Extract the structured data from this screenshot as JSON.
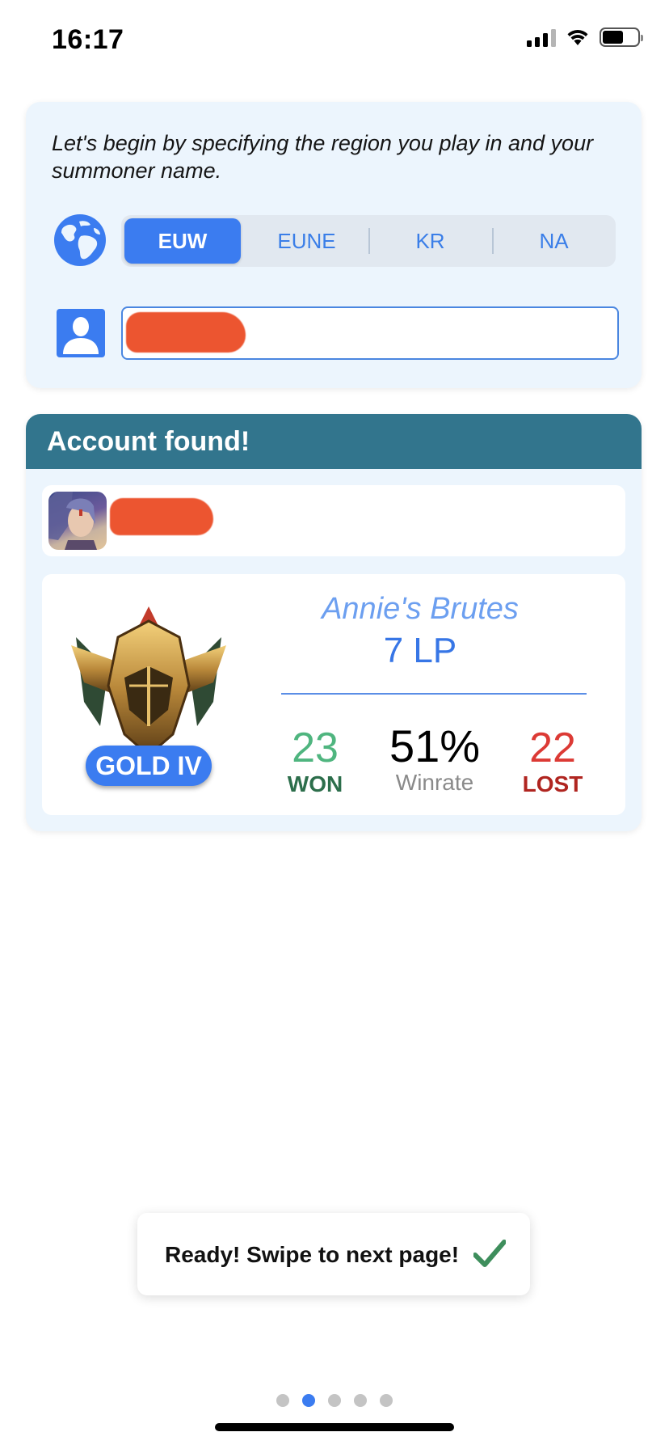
{
  "status_bar": {
    "time": "16:17",
    "battery_level": 0.6
  },
  "region_card": {
    "intro": "Let's begin by specifying the region you play in and your summoner name.",
    "globe_icon": "globe-icon",
    "regions": [
      "EUW",
      "EUNE",
      "KR",
      "NA"
    ],
    "selected_region": "EUW",
    "user_icon": "user-icon",
    "summoner_name_value": ""
  },
  "account": {
    "header": "Account found!",
    "summoner_name": "",
    "avatar_icon": "champion-avatar",
    "tier": "GOLD IV",
    "league_name": "Annie's Brutes",
    "lp": "7 LP",
    "wins": "23",
    "wins_label": "WON",
    "winrate": "51%",
    "winrate_label": "Winrate",
    "losses": "22",
    "losses_label": "LOST"
  },
  "toast": {
    "message": "Ready! Swipe to next page!",
    "icon": "checkmark-icon"
  },
  "pager": {
    "total": 5,
    "current": 2
  },
  "colors": {
    "accent": "#3b7cf0",
    "header": "#32758d",
    "card_bg": "#ecf5fd",
    "won": "#4fb57f",
    "lost": "#dc3a35",
    "redaction": "#ec5530"
  }
}
